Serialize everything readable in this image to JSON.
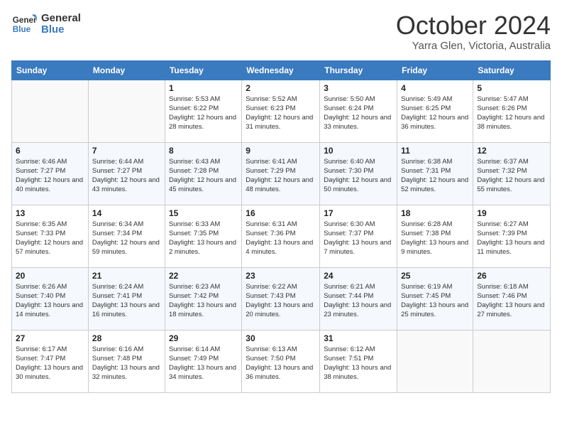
{
  "logo": {
    "line1": "General",
    "line2": "Blue"
  },
  "title": "October 2024",
  "location": "Yarra Glen, Victoria, Australia",
  "days_of_week": [
    "Sunday",
    "Monday",
    "Tuesday",
    "Wednesday",
    "Thursday",
    "Friday",
    "Saturday"
  ],
  "weeks": [
    [
      {
        "day": "",
        "info": ""
      },
      {
        "day": "",
        "info": ""
      },
      {
        "day": "1",
        "info": "Sunrise: 5:53 AM\nSunset: 6:22 PM\nDaylight: 12 hours and 28 minutes."
      },
      {
        "day": "2",
        "info": "Sunrise: 5:52 AM\nSunset: 6:23 PM\nDaylight: 12 hours and 31 minutes."
      },
      {
        "day": "3",
        "info": "Sunrise: 5:50 AM\nSunset: 6:24 PM\nDaylight: 12 hours and 33 minutes."
      },
      {
        "day": "4",
        "info": "Sunrise: 5:49 AM\nSunset: 6:25 PM\nDaylight: 12 hours and 36 minutes."
      },
      {
        "day": "5",
        "info": "Sunrise: 5:47 AM\nSunset: 6:26 PM\nDaylight: 12 hours and 38 minutes."
      }
    ],
    [
      {
        "day": "6",
        "info": "Sunrise: 6:46 AM\nSunset: 7:27 PM\nDaylight: 12 hours and 40 minutes."
      },
      {
        "day": "7",
        "info": "Sunrise: 6:44 AM\nSunset: 7:27 PM\nDaylight: 12 hours and 43 minutes."
      },
      {
        "day": "8",
        "info": "Sunrise: 6:43 AM\nSunset: 7:28 PM\nDaylight: 12 hours and 45 minutes."
      },
      {
        "day": "9",
        "info": "Sunrise: 6:41 AM\nSunset: 7:29 PM\nDaylight: 12 hours and 48 minutes."
      },
      {
        "day": "10",
        "info": "Sunrise: 6:40 AM\nSunset: 7:30 PM\nDaylight: 12 hours and 50 minutes."
      },
      {
        "day": "11",
        "info": "Sunrise: 6:38 AM\nSunset: 7:31 PM\nDaylight: 12 hours and 52 minutes."
      },
      {
        "day": "12",
        "info": "Sunrise: 6:37 AM\nSunset: 7:32 PM\nDaylight: 12 hours and 55 minutes."
      }
    ],
    [
      {
        "day": "13",
        "info": "Sunrise: 6:35 AM\nSunset: 7:33 PM\nDaylight: 12 hours and 57 minutes."
      },
      {
        "day": "14",
        "info": "Sunrise: 6:34 AM\nSunset: 7:34 PM\nDaylight: 12 hours and 59 minutes."
      },
      {
        "day": "15",
        "info": "Sunrise: 6:33 AM\nSunset: 7:35 PM\nDaylight: 13 hours and 2 minutes."
      },
      {
        "day": "16",
        "info": "Sunrise: 6:31 AM\nSunset: 7:36 PM\nDaylight: 13 hours and 4 minutes."
      },
      {
        "day": "17",
        "info": "Sunrise: 6:30 AM\nSunset: 7:37 PM\nDaylight: 13 hours and 7 minutes."
      },
      {
        "day": "18",
        "info": "Sunrise: 6:28 AM\nSunset: 7:38 PM\nDaylight: 13 hours and 9 minutes."
      },
      {
        "day": "19",
        "info": "Sunrise: 6:27 AM\nSunset: 7:39 PM\nDaylight: 13 hours and 11 minutes."
      }
    ],
    [
      {
        "day": "20",
        "info": "Sunrise: 6:26 AM\nSunset: 7:40 PM\nDaylight: 13 hours and 14 minutes."
      },
      {
        "day": "21",
        "info": "Sunrise: 6:24 AM\nSunset: 7:41 PM\nDaylight: 13 hours and 16 minutes."
      },
      {
        "day": "22",
        "info": "Sunrise: 6:23 AM\nSunset: 7:42 PM\nDaylight: 13 hours and 18 minutes."
      },
      {
        "day": "23",
        "info": "Sunrise: 6:22 AM\nSunset: 7:43 PM\nDaylight: 13 hours and 20 minutes."
      },
      {
        "day": "24",
        "info": "Sunrise: 6:21 AM\nSunset: 7:44 PM\nDaylight: 13 hours and 23 minutes."
      },
      {
        "day": "25",
        "info": "Sunrise: 6:19 AM\nSunset: 7:45 PM\nDaylight: 13 hours and 25 minutes."
      },
      {
        "day": "26",
        "info": "Sunrise: 6:18 AM\nSunset: 7:46 PM\nDaylight: 13 hours and 27 minutes."
      }
    ],
    [
      {
        "day": "27",
        "info": "Sunrise: 6:17 AM\nSunset: 7:47 PM\nDaylight: 13 hours and 30 minutes."
      },
      {
        "day": "28",
        "info": "Sunrise: 6:16 AM\nSunset: 7:48 PM\nDaylight: 13 hours and 32 minutes."
      },
      {
        "day": "29",
        "info": "Sunrise: 6:14 AM\nSunset: 7:49 PM\nDaylight: 13 hours and 34 minutes."
      },
      {
        "day": "30",
        "info": "Sunrise: 6:13 AM\nSunset: 7:50 PM\nDaylight: 13 hours and 36 minutes."
      },
      {
        "day": "31",
        "info": "Sunrise: 6:12 AM\nSunset: 7:51 PM\nDaylight: 13 hours and 38 minutes."
      },
      {
        "day": "",
        "info": ""
      },
      {
        "day": "",
        "info": ""
      }
    ]
  ]
}
